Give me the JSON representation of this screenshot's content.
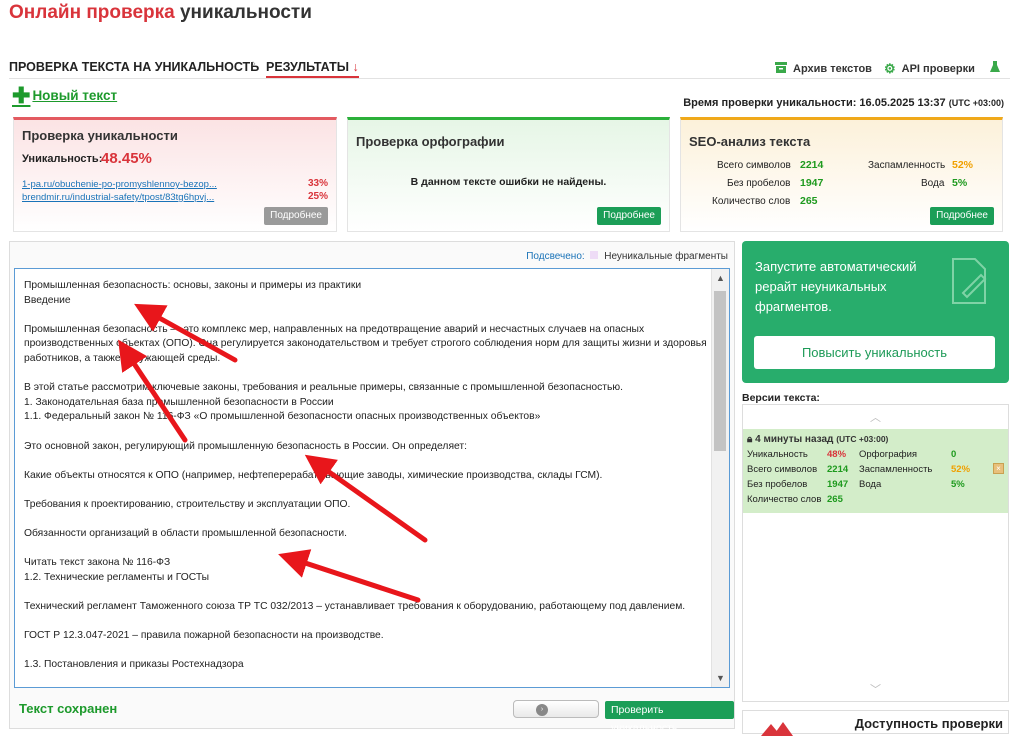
{
  "page_title": {
    "part1": "Онлайн проверка",
    "part2": "уникальности"
  },
  "nav": {
    "step1": "ПРОВЕРКА ТЕКСТА НА УНИКАЛЬНОСТЬ",
    "step2": "РЕЗУЛЬТАТЫ",
    "step2_arrow": "↓",
    "archive": "Архив текстов",
    "api": "API проверки"
  },
  "new_text": "Новый текст",
  "check_time": {
    "label": "Время проверки уникальности: 16.05.2025 13:37",
    "tz": "(UTC +03:00)"
  },
  "uniqueness_card": {
    "title": "Проверка уникальности",
    "label": "Уникальность:",
    "value": "48.45%",
    "sources": [
      {
        "url": "1-pa.ru/obuchenie-po-promyshlennoy-bezop...",
        "percent": "33%"
      },
      {
        "url": "brendmir.ru/industrial-safety/tpost/83tg6hpvj...",
        "percent": "25%"
      }
    ],
    "more": "Подробнее"
  },
  "spelling_card": {
    "title": "Проверка орфографии",
    "message": "В данном тексте ошибки не найдены.",
    "more": "Подробнее"
  },
  "seo_card": {
    "title": "SEO-анализ текста",
    "total_chars_label": "Всего символов",
    "total_chars": "2214",
    "no_spaces_label": "Без пробелов",
    "no_spaces": "1947",
    "words_label": "Количество слов",
    "words": "265",
    "spam_label": "Заспамленность",
    "spam": "52%",
    "water_label": "Вода",
    "water": "5%",
    "more": "Подробнее"
  },
  "editor": {
    "legend_label": "Подсвечено:",
    "legend_item": "Неуникальные фрагменты",
    "lines": [
      "Промышленная безопасность: основы, законы и примеры из практики",
      "Введение",
      "",
      "Промышленная безопасность — это комплекс мер, направленных на предотвращение аварий и несчастных случаев на опасных",
      "производственных объектах (ОПО). Она регулируется законодательством и требует строгого соблюдения норм для защиты жизни и здоровья",
      "работников, а также окружающей среды.",
      "",
      "В этой статье рассмотрим ключевые законы, требования и реальные примеры, связанные с промышленной безопасностью.",
      "1. Законодательная база промышленной безопасности в России",
      "1.1. Федеральный закон № 116-ФЗ «О промышленной безопасности опасных производственных объектов»",
      "",
      "Это основной закон, регулирующий промышленную безопасность в России. Он определяет:",
      "",
      "Какие объекты относятся к ОПО (например, нефтеперерабатывающие заводы, химические производства, склады ГСМ).",
      "",
      "Требования к проектированию, строительству и эксплуатации ОПО.",
      "",
      "Обязанности организаций в области промышленной безопасности.",
      "",
      "Читать текст закона № 116-ФЗ",
      "1.2. Технические регламенты и ГОСТы",
      "",
      "Технический регламент Таможенного союза ТР ТС 032/2013 – устанавливает требования к оборудованию, работающему под давлением.",
      "",
      "ГОСТ Р 12.3.047-2021 – правила пожарной безопасности на производстве.",
      "",
      "1.3. Постановления и приказы Ростехнадзора"
    ],
    "saved": "Текст сохранен",
    "check_button": "Проверить уникальность"
  },
  "promo": {
    "text": "Запустите автоматический рерайт неуникальных фрагментов.",
    "button": "Повысить уникальность"
  },
  "versions": {
    "title": "Версии текста:",
    "item": {
      "time": "4 минуты назад",
      "tz": "(UTC +03:00)",
      "uniq_label": "Уникальность",
      "uniq": "48%",
      "chars_label": "Всего символов",
      "chars": "2214",
      "nospace_label": "Без пробелов",
      "nospace": "1947",
      "words_label": "Количество слов",
      "words": "265",
      "spell_label": "Орфография",
      "spell": "0",
      "spam_label": "Заспамленность",
      "spam": "52%",
      "water_label": "Вода",
      "water": "5%"
    }
  },
  "access": {
    "title": "Доступность проверки"
  },
  "colors": {
    "accent_red": "#d9343b",
    "green": "#1b9e57",
    "highlight": "#eedcf6",
    "arrow": "#e8161b"
  }
}
